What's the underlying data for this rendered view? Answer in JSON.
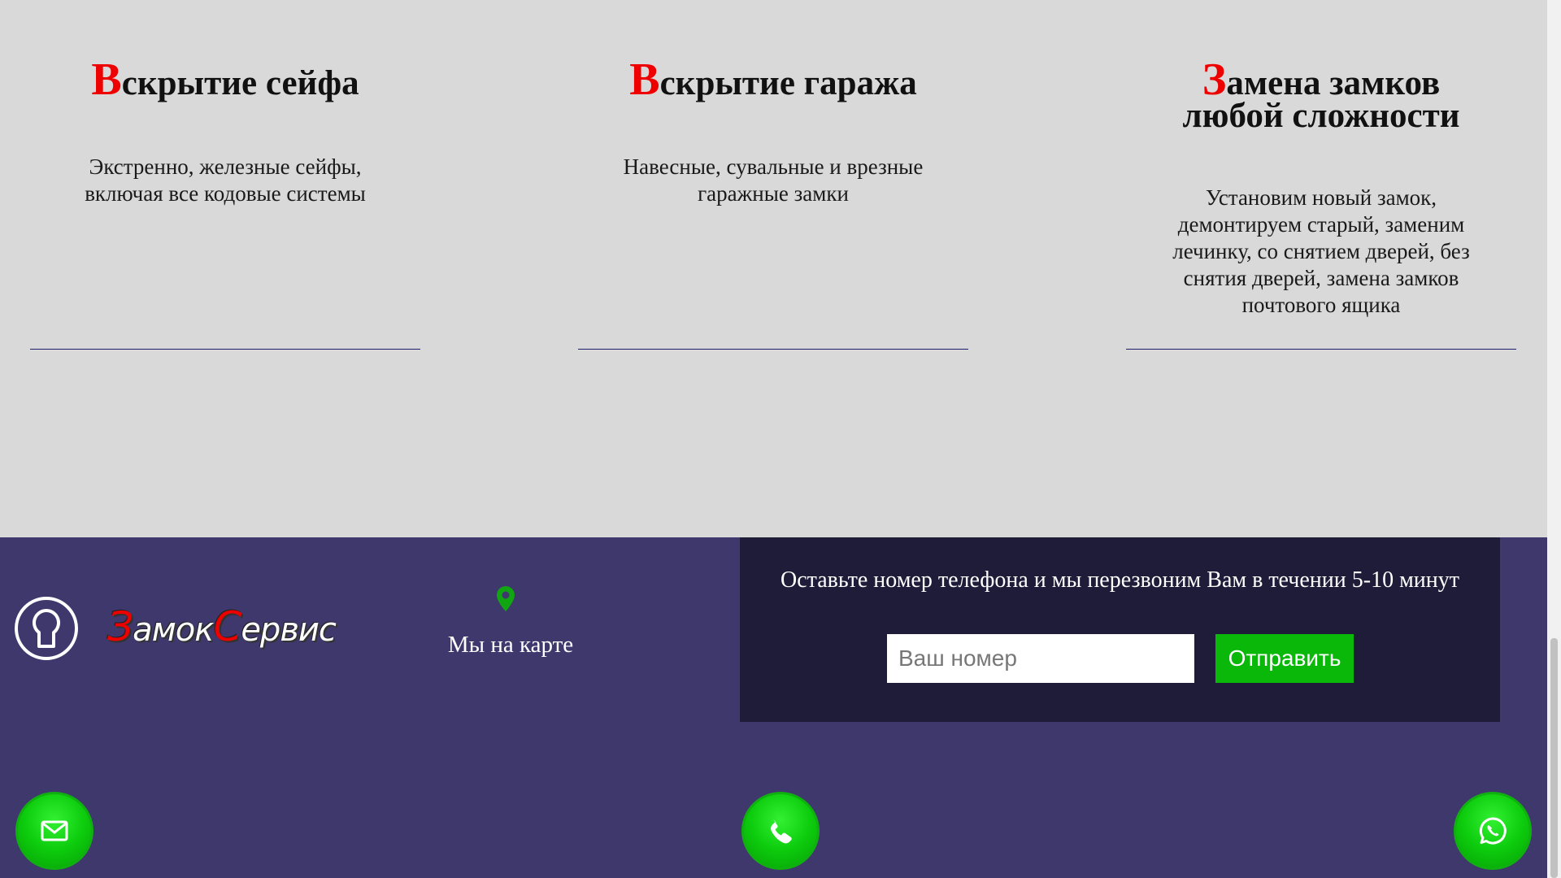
{
  "services": [
    {
      "title_first": "В",
      "title_rest": "скрытие сейфа",
      "text": "Экстренно, железные сейфы, включая все кодовые системы"
    },
    {
      "title_first": "В",
      "title_rest": "скрытие гаража",
      "text": "Навесные, сувальные и врезные гаражные замки"
    },
    {
      "title_first": "З",
      "title_rest": "амена замков любой сложности",
      "text": "Установим новый замок, демонтируем старый, заменим лечинку, со снятием дверей, без снятия дверей, замена замков почтового ящика"
    }
  ],
  "footer": {
    "logo_icon": "keyhole-icon",
    "brand_first": "З",
    "brand_mid": "амок",
    "brand_second": "С",
    "brand_rest": "ервис",
    "map_icon": "map-pin-icon",
    "map_label": "Мы на карте",
    "callback_text": "Оставьте номер телефона и мы перезвоним Вам в течении 5-10 минут",
    "phone_placeholder": "Ваш номер",
    "phone_value": "",
    "submit_label": "Отправить"
  },
  "fabs": [
    {
      "icon": "mail-icon"
    },
    {
      "icon": "phone-icon"
    },
    {
      "icon": "whatsapp-icon"
    }
  ],
  "colors": {
    "accent_red": "#ee0000",
    "footer_bg": "#3e386d",
    "callback_bg": "#1e1c38",
    "button_green": "#09b809",
    "page_bg": "#d9d9d9"
  }
}
